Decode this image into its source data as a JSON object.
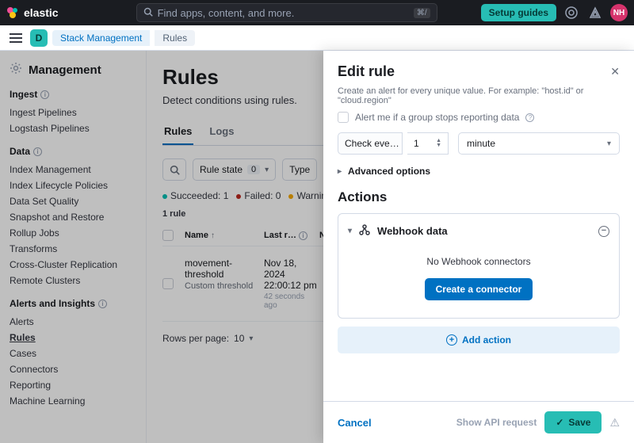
{
  "header": {
    "logo_text": "elastic",
    "search_placeholder": "Find apps, content, and more.",
    "search_kbd": "⌘/",
    "setup_label": "Setup guides",
    "avatar_initials": "NH",
    "space_initial": "D"
  },
  "breadcrumbs": {
    "a": "Stack Management",
    "b": "Rules"
  },
  "sidebar": {
    "title": "Management",
    "groups": [
      {
        "title": "Ingest",
        "info": true,
        "items": [
          "Ingest Pipelines",
          "Logstash Pipelines"
        ]
      },
      {
        "title": "Data",
        "info": true,
        "items": [
          "Index Management",
          "Index Lifecycle Policies",
          "Data Set Quality",
          "Snapshot and Restore",
          "Rollup Jobs",
          "Transforms",
          "Cross-Cluster Replication",
          "Remote Clusters"
        ]
      },
      {
        "title": "Alerts and Insights",
        "info": true,
        "items": [
          "Alerts",
          "Rules",
          "Cases",
          "Connectors",
          "Reporting",
          "Machine Learning"
        ],
        "active": "Rules"
      }
    ]
  },
  "page": {
    "title": "Rules",
    "subtitle": "Detect conditions using rules.",
    "tabs": [
      "Rules",
      "Logs"
    ],
    "active_tab": "Rules",
    "filters": {
      "rule_state_label": "Rule state",
      "rule_state_count": "0",
      "type_label": "Type"
    },
    "status": {
      "succeeded_label": "Succeeded:",
      "succeeded_n": "1",
      "failed_label": "Failed:",
      "failed_n": "0",
      "warning_label": "Warning:"
    },
    "count_line": "1 rule",
    "cols": {
      "name": "Name",
      "last": "Last r…",
      "n": "N"
    },
    "row": {
      "name": "movement-threshold",
      "type": "Custom threshold",
      "last_run": "Nov 18, 2024 22:00:12 pm",
      "ago": "42 seconds ago"
    },
    "pager": {
      "label": "Rows per page:",
      "value": "10"
    }
  },
  "flyout": {
    "title": "Edit rule",
    "hint": "Create an alert for every unique value. For example: \"host.id\" or \"cloud.region\"",
    "alert_me": "Alert me if a group stops reporting data",
    "check_every": "Check eve…",
    "interval_value": "1",
    "interval_unit": "minute",
    "advanced": "Advanced options",
    "actions_title": "Actions",
    "webhook_label": "Webhook data",
    "no_connectors": "No Webhook connectors",
    "create_connector": "Create a connector",
    "add_action": "Add action",
    "cancel": "Cancel",
    "show_api": "Show API request",
    "save": "Save"
  }
}
